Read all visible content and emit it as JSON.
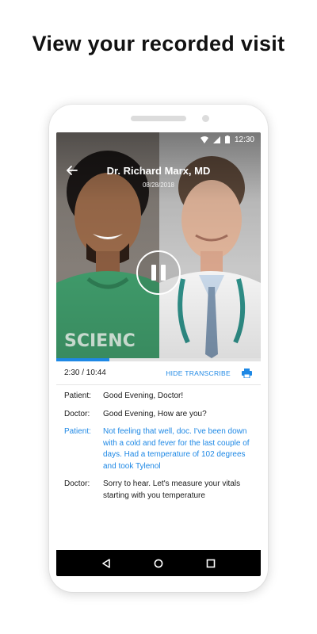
{
  "headline": "View your recorded visit",
  "status_bar": {
    "time": "12:30"
  },
  "video": {
    "doctor_name": "Dr. Richard Marx, MD",
    "date": "08/28/2018",
    "progress_fraction": 0.26
  },
  "controls": {
    "time": "2:30 / 10:44",
    "hide_transcript_label": "HIDE TRANSCRIBE"
  },
  "transcript": [
    {
      "speaker": "Patient:",
      "text": "Good Evening, Doctor!",
      "active": false
    },
    {
      "speaker": "Doctor:",
      "text": "Good Evening, How are you?",
      "active": false
    },
    {
      "speaker": "Patient:",
      "text": "Not feeling that well, doc. I've been down with a cold and fever for the last couple of days. Had a temperature of 102 degrees and took Tylenol",
      "active": true
    },
    {
      "speaker": "Doctor:",
      "text": "Sorry to hear. Let's measure your vitals starting with you temperature",
      "active": false
    }
  ],
  "colors": {
    "accent": "#1e88e5",
    "navbar": "#000000"
  },
  "icons": [
    "wifi-icon",
    "signal-icon",
    "battery-icon",
    "back-arrow-icon",
    "pause-icon",
    "print-icon",
    "nav-back-icon",
    "nav-home-icon",
    "nav-recents-icon"
  ]
}
